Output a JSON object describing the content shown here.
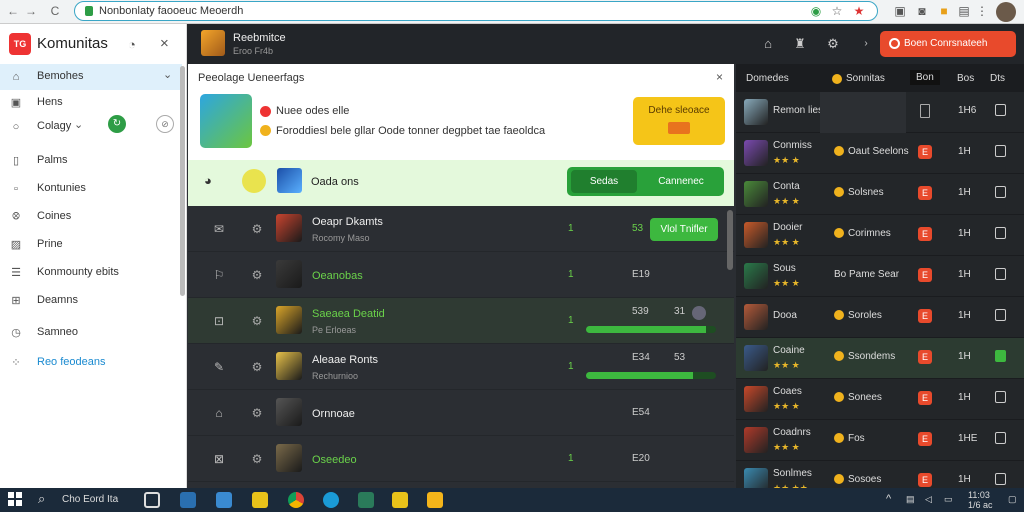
{
  "browser": {
    "url": "Nonbonlaty faooeuc Meoerdh",
    "back": "←",
    "forward": "→",
    "reload": "C"
  },
  "sidebar": {
    "app_title": "Komunitas",
    "logo_text": "TG",
    "items": [
      {
        "label": "Bemohes",
        "icon": "home-icon"
      },
      {
        "label": "Hens",
        "icon": "image-icon"
      },
      {
        "label": "Colagy",
        "icon": "circle-icon"
      },
      {
        "label": "Palms",
        "icon": "doc-icon"
      },
      {
        "label": "Kontunies",
        "icon": "square-icon"
      },
      {
        "label": "Coines",
        "icon": "people-icon"
      },
      {
        "label": "Prine",
        "icon": "photo-icon"
      },
      {
        "label": "Konmounty ebits",
        "icon": "list-icon"
      },
      {
        "label": "Deamns",
        "icon": "grid-icon"
      },
      {
        "label": "Samneo",
        "icon": "clock-icon"
      },
      {
        "label": "Reo feodeans",
        "icon": "apps-icon"
      }
    ]
  },
  "header": {
    "game_title": "Reebmitce",
    "game_sub": "Eroo Fr4b",
    "cta": "Boen Conrsnateeh Nontas"
  },
  "notification": {
    "title": "Peeolage Ueneerfags",
    "line1": "Nuee odes elle",
    "line2": "Foroddiesl bele gllar Oode tonner degpbet tae faeoldca",
    "button": "Dehe sleoace"
  },
  "green_row": {
    "name": "Oada ons",
    "btn1": "Sedas",
    "btn2": "Cannenec"
  },
  "list": [
    {
      "name": "Oeapr Dkamts",
      "sub": "Rocomy Maso",
      "dot": "1",
      "num": "53",
      "button": "Vlol Tnifler",
      "color": "#c9442f"
    },
    {
      "name": "Oeanobas",
      "sub": "",
      "dot": "1",
      "num": "E19",
      "color": "#3a3a3a"
    },
    {
      "name": "Saeaea Deatid",
      "sub": "Pe Erloeas",
      "dot": "1",
      "num": "539",
      "num2": "31",
      "progress": 0.92,
      "color": "#d9a52a"
    },
    {
      "name": "Aleaae Ronts",
      "sub": "Rechurnioo",
      "dot": "1",
      "num": "E34",
      "num2": "53",
      "progress": 0.82,
      "color": "#e8c24a"
    },
    {
      "name": "Ornnoae",
      "sub": "",
      "dot": "",
      "num": "E54",
      "color": "#555"
    },
    {
      "name": "Oseedeo",
      "sub": "",
      "dot": "1",
      "num": "E20",
      "color": "#7a6a4a"
    }
  ],
  "right_panel": {
    "headers": [
      "Domedes",
      "Sonnitas",
      "Bon",
      "Bos",
      "Dts"
    ],
    "rows": [
      {
        "name": "Remon lies",
        "stars": "",
        "label": "",
        "badge": "",
        "num": "1H6",
        "checked": false,
        "color": "#8ab"
      },
      {
        "name": "Conmiss",
        "stars": "★★ ★",
        "label": "Oaut Seelons",
        "badge": "E",
        "num": "1H",
        "checked": false,
        "color": "#7a4ab0"
      },
      {
        "name": "Conta",
        "stars": "★★ ★",
        "label": "Solsnes",
        "badge": "E",
        "num": "1H",
        "checked": false,
        "color": "#4a8a3a"
      },
      {
        "name": "Dooier",
        "stars": "★★ ★",
        "label": "Corimnes",
        "badge": "E",
        "num": "1H",
        "checked": false,
        "color": "#c85a2a"
      },
      {
        "name": "Sous",
        "stars": "★★ ★",
        "label": "Bo Pame Sear",
        "badge": "E",
        "num": "1H",
        "checked": false,
        "color": "#2a7a4a"
      },
      {
        "name": "Dooa",
        "stars": "",
        "label": "Soroles",
        "badge": "E",
        "num": "1H",
        "checked": false,
        "color": "#b45a3a"
      },
      {
        "name": "Coaine",
        "stars": "★★ ★",
        "label": "Ssondems",
        "badge": "E",
        "num": "1H",
        "checked": true,
        "color": "#3a5a8a"
      },
      {
        "name": "Coaes",
        "stars": "★★ ★",
        "label": "Sonees",
        "badge": "E",
        "num": "1H",
        "checked": false,
        "color": "#c8482a"
      },
      {
        "name": "Coadnrs",
        "stars": "★★ ★",
        "label": "Fos",
        "badge": "E",
        "num": "1HE",
        "checked": false,
        "color": "#b03a2a"
      },
      {
        "name": "Sonlmes",
        "stars": "★★ ★★",
        "label": "Sosoes",
        "badge": "E",
        "num": "1H",
        "checked": false,
        "color": "#3a8ab0"
      }
    ]
  },
  "taskbar": {
    "search": "Cho Eord Ita",
    "time": "11:03",
    "date": "1/6 ac"
  }
}
